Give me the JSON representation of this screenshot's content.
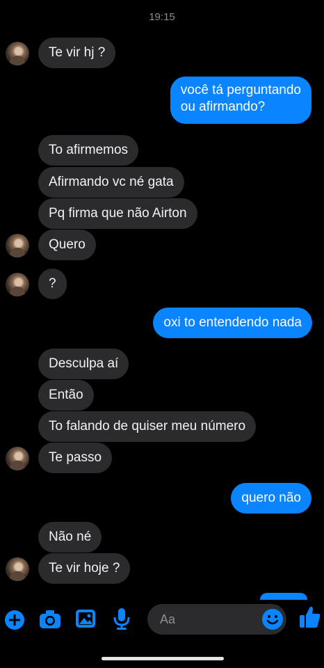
{
  "status_bar": {
    "time": "19:15"
  },
  "messages": [
    {
      "id": "m1",
      "dir": "in",
      "text": "Te vir hj ?",
      "avatar": true
    },
    {
      "id": "m2",
      "dir": "out",
      "line1": "você tá perguntando",
      "line2": "ou afirmando?"
    },
    {
      "id": "m3",
      "dir": "in",
      "text": "To afirmemos"
    },
    {
      "id": "m4",
      "dir": "in",
      "text": "Afirmando vc né gata"
    },
    {
      "id": "m5",
      "dir": "in",
      "text": "Pq firma que não Airton"
    },
    {
      "id": "m6",
      "dir": "in",
      "text": "Quero",
      "avatar": true
    },
    {
      "id": "m7",
      "dir": "in",
      "text": "?",
      "avatar": true
    },
    {
      "id": "m8",
      "dir": "out",
      "text": "oxi to entendendo nada"
    },
    {
      "id": "m9",
      "dir": "in",
      "text": "Desculpa aí"
    },
    {
      "id": "m10",
      "dir": "in",
      "text": "Então"
    },
    {
      "id": "m11",
      "dir": "in",
      "text": "To falando de quiser meu número"
    },
    {
      "id": "m12",
      "dir": "in",
      "text": "Te passo",
      "avatar": true
    },
    {
      "id": "m13",
      "dir": "out",
      "text": "quero não"
    },
    {
      "id": "m14",
      "dir": "in",
      "text": "Não né"
    },
    {
      "id": "m15",
      "dir": "in",
      "text": "Te vir hoje ?",
      "avatar": true
    }
  ],
  "composer": {
    "placeholder": "Aa",
    "icons": [
      "plus-icon",
      "camera-icon",
      "gallery-icon",
      "microphone-icon",
      "emoji-icon",
      "thumbs-up-icon"
    ]
  },
  "colors": {
    "accent": "#0a84ff",
    "incoming_bubble": "#2b2b2d",
    "background": "#000000"
  }
}
